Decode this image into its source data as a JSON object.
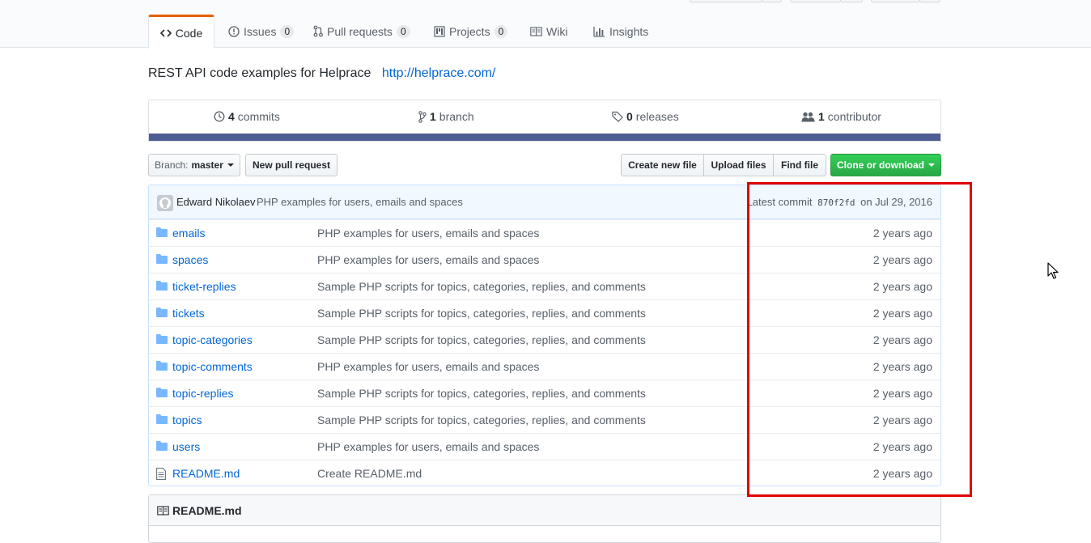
{
  "tabs": [
    {
      "label": "Code",
      "icon": "code-icon",
      "selected": true
    },
    {
      "label": "Issues",
      "icon": "issue-opened-icon",
      "count": "0"
    },
    {
      "label": "Pull requests",
      "icon": "git-pull-request-icon",
      "count": "0"
    },
    {
      "label": "Projects",
      "icon": "project-icon",
      "count": "0"
    },
    {
      "label": "Wiki",
      "icon": "book-icon"
    },
    {
      "label": "Insights",
      "icon": "graph-icon"
    }
  ],
  "repo": {
    "description": "REST API code examples for Helprace",
    "homepage": "http://helprace.com/"
  },
  "summary": {
    "commits": {
      "count": "4",
      "label": "commits"
    },
    "branches": {
      "count": "1",
      "label": "branch"
    },
    "releases": {
      "count": "0",
      "label": "releases"
    },
    "contributors": {
      "count": "1",
      "label": "contributor"
    },
    "language_color": "#4F5D95"
  },
  "actions": {
    "branch_label": "Branch:",
    "branch_name": "master",
    "new_pull_request": "New pull request",
    "create_new_file": "Create new file",
    "upload_files": "Upload files",
    "find_file": "Find file",
    "clone_or_download": "Clone or download"
  },
  "latest_commit": {
    "author": "Edward Nikolaev",
    "message": "PHP examples for users, emails and spaces",
    "prefix": "Latest commit",
    "sha": "870f2fd",
    "date": "on Jul 29, 2016"
  },
  "files": [
    {
      "name": "emails",
      "type": "dir",
      "message": "PHP examples for users, emails and spaces",
      "age": "2 years ago"
    },
    {
      "name": "spaces",
      "type": "dir",
      "message": "PHP examples for users, emails and spaces",
      "age": "2 years ago"
    },
    {
      "name": "ticket-replies",
      "type": "dir",
      "message": "Sample PHP scripts for topics, categories, replies, and comments",
      "age": "2 years ago"
    },
    {
      "name": "tickets",
      "type": "dir",
      "message": "Sample PHP scripts for topics, categories, replies, and comments",
      "age": "2 years ago"
    },
    {
      "name": "topic-categories",
      "type": "dir",
      "message": "Sample PHP scripts for topics, categories, replies, and comments",
      "age": "2 years ago"
    },
    {
      "name": "topic-comments",
      "type": "dir",
      "message": "PHP examples for users, emails and spaces",
      "age": "2 years ago"
    },
    {
      "name": "topic-replies",
      "type": "dir",
      "message": "Sample PHP scripts for topics, categories, replies, and comments",
      "age": "2 years ago"
    },
    {
      "name": "topics",
      "type": "dir",
      "message": "Sample PHP scripts for topics, categories, replies, and comments",
      "age": "2 years ago"
    },
    {
      "name": "users",
      "type": "dir",
      "message": "PHP examples for users, emails and spaces",
      "age": "2 years ago"
    },
    {
      "name": "README.md",
      "type": "file",
      "message": "Create README.md",
      "age": "2 years ago"
    }
  ],
  "readme": {
    "title": "README.md"
  },
  "annotation": {
    "color": "#e00000"
  }
}
